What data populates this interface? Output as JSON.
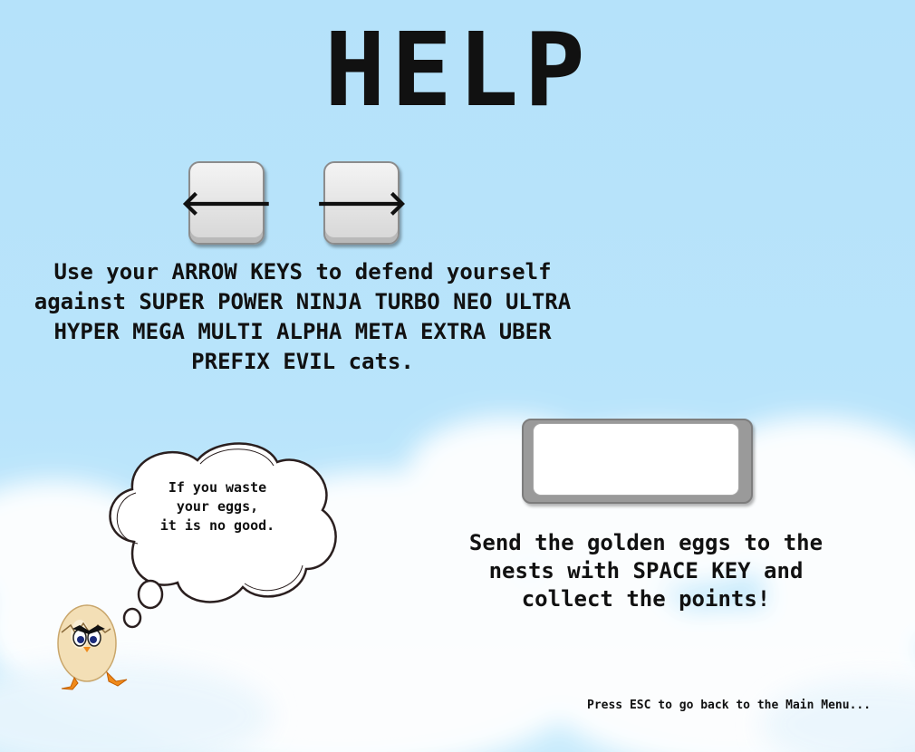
{
  "title": "HELP",
  "controls": {
    "left_key": {
      "icon": "arrow-left-icon",
      "glyph": "🡐"
    },
    "right_key": {
      "icon": "arrow-right-icon",
      "glyph": "🡒"
    },
    "arrow_instructions": "Use your ARROW KEYS to defend yourself\nagainst SUPER POWER NINJA TURBO NEO ULTRA\nHYPER MEGA MULTI ALPHA META EXTRA UBER\nPREFIX EVIL cats.",
    "space_key": {
      "icon": "space-key-icon"
    },
    "space_instructions": "Send the golden eggs to the\nnests with SPACE KEY and\ncollect the points!"
  },
  "character": {
    "icon": "egg-chick-icon",
    "thought": "If you waste\nyour eggs,\nit is no good."
  },
  "footer": {
    "esc_hint": "Press ESC to go back to the Main Menu..."
  },
  "colors": {
    "sky": "#b7e3fa",
    "text": "#111111",
    "key_face": "#e6e6e6"
  }
}
